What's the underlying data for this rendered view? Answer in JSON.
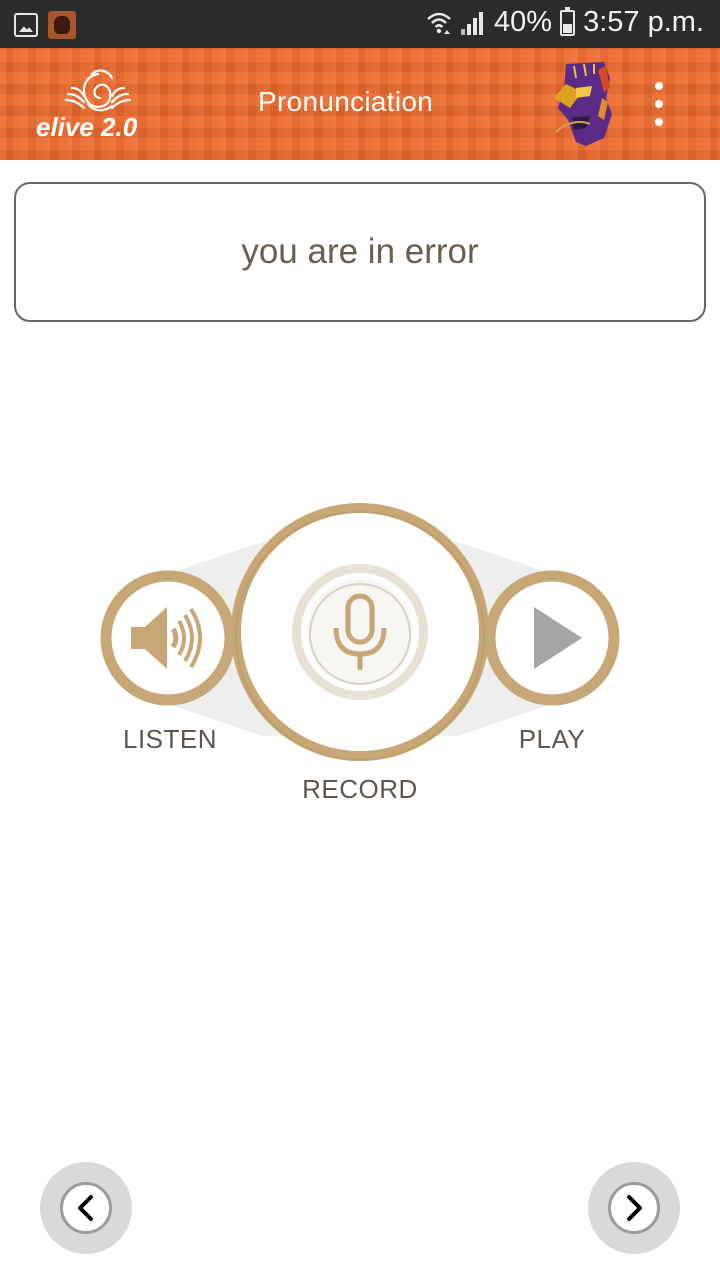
{
  "status_bar": {
    "battery_percent": "40%",
    "time": "3:57 p.m.",
    "icons": [
      "gallery-notification-icon",
      "app-notification-icon",
      "wifi-icon",
      "signal-icon",
      "battery-icon"
    ]
  },
  "app_bar": {
    "logo_text": "elive 2.0",
    "title": "Pronunciation",
    "icons": [
      "app-logo",
      "profile-avatar",
      "overflow-menu-icon"
    ]
  },
  "phrase": {
    "text": "you are in error"
  },
  "controls": {
    "listen_label": "LISTEN",
    "record_label": "RECORD",
    "play_label": "PLAY",
    "icons": [
      "speaker-icon",
      "microphone-icon",
      "play-icon"
    ]
  },
  "navigation": {
    "icons": [
      "chevron-left-icon",
      "chevron-right-icon"
    ]
  },
  "colors": {
    "status_bar": "#2b2b2b",
    "app_bar": "#ec6a2c",
    "accent_gold": "#c6a775",
    "text": "#6a5e52",
    "icon_gray": "#a5a5a5"
  }
}
